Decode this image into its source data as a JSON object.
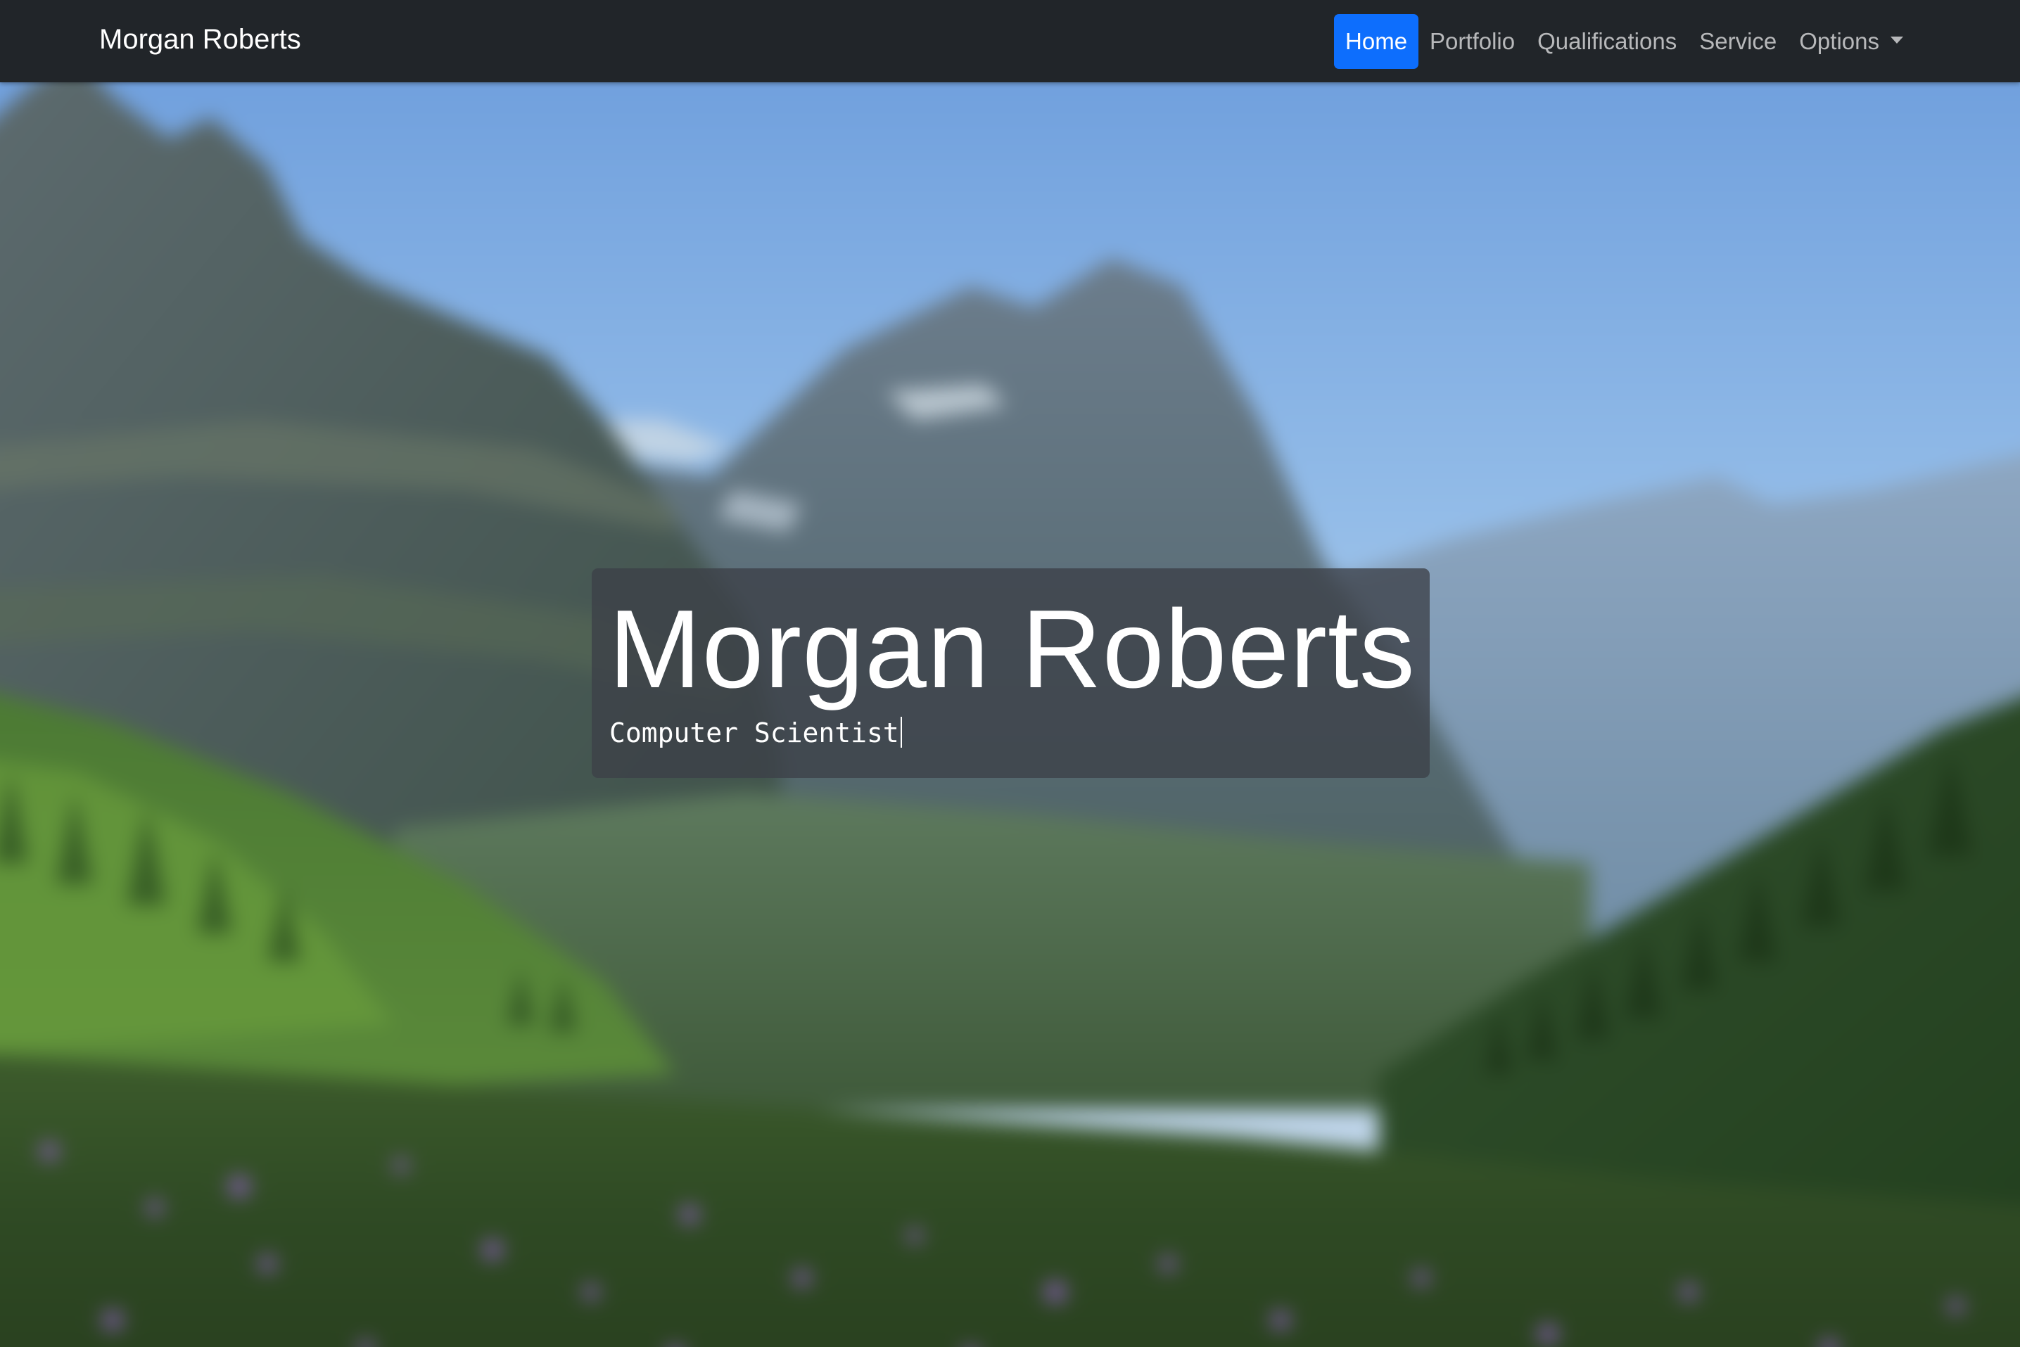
{
  "navbar": {
    "brand": "Morgan Roberts",
    "items": [
      {
        "label": "Home",
        "active": true
      },
      {
        "label": "Portfolio",
        "active": false
      },
      {
        "label": "Qualifications",
        "active": false
      },
      {
        "label": "Service",
        "active": false
      },
      {
        "label": "Options",
        "active": false,
        "dropdown": true
      }
    ]
  },
  "hero": {
    "background": "blurred mountain valley landscape with wildflower meadow",
    "title": "Morgan Roberts",
    "subtitle": "Computer Scientist"
  },
  "colors": {
    "navbar_bg": "#212529",
    "active_nav_bg": "#0d6efd",
    "card_bg": "rgba(60,64,72,0.78)",
    "text": "#ffffff"
  }
}
